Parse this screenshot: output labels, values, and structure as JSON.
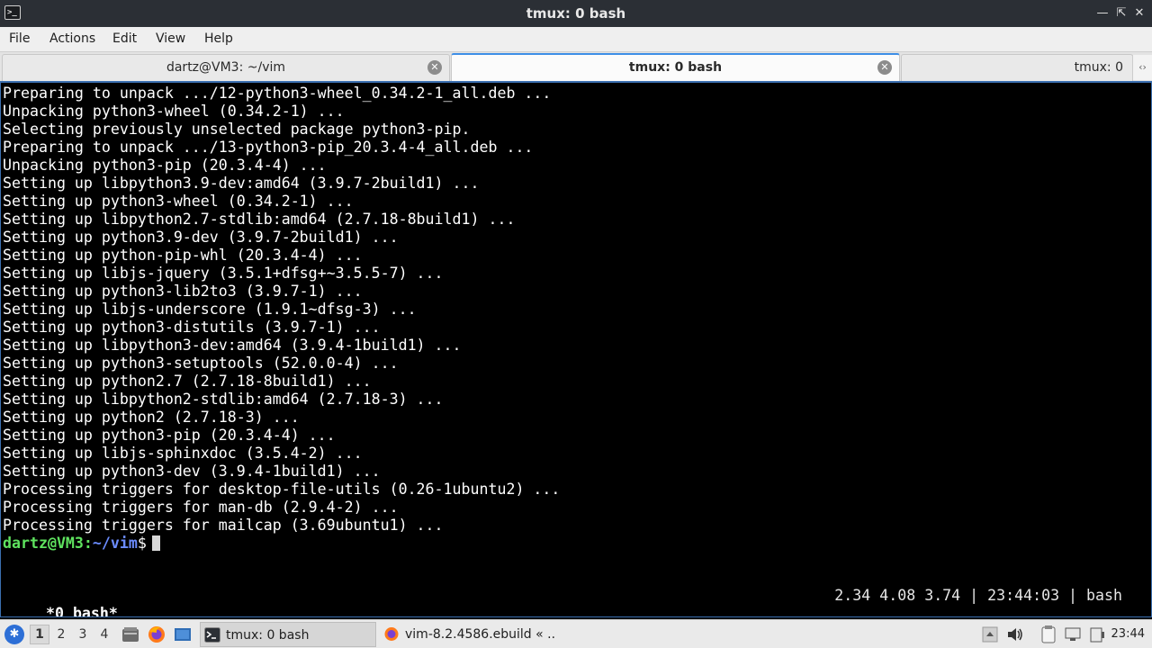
{
  "window": {
    "title": "tmux: 0 bash",
    "icon": "terminal-icon",
    "controls": [
      "minimize-icon",
      "restore-icon",
      "close-icon"
    ]
  },
  "menu": [
    "File",
    "Actions",
    "Edit",
    "View",
    "Help"
  ],
  "tabs": [
    {
      "label": "dartz@VM3: ~/vim",
      "active": false
    },
    {
      "label": "tmux: 0 bash",
      "active": true
    },
    {
      "label": "tmux: 0",
      "active": false
    }
  ],
  "terminal": {
    "lines": [
      "Preparing to unpack .../12-python3-wheel_0.34.2-1_all.deb ...",
      "Unpacking python3-wheel (0.34.2-1) ...",
      "Selecting previously unselected package python3-pip.",
      "Preparing to unpack .../13-python3-pip_20.3.4-4_all.deb ...",
      "Unpacking python3-pip (20.3.4-4) ...",
      "Setting up libpython3.9-dev:amd64 (3.9.7-2build1) ...",
      "Setting up python3-wheel (0.34.2-1) ...",
      "Setting up libpython2.7-stdlib:amd64 (2.7.18-8build1) ...",
      "Setting up python3.9-dev (3.9.7-2build1) ...",
      "Setting up python-pip-whl (20.3.4-4) ...",
      "Setting up libjs-jquery (3.5.1+dfsg+~3.5.5-7) ...",
      "Setting up python3-lib2to3 (3.9.7-1) ...",
      "Setting up libjs-underscore (1.9.1~dfsg-3) ...",
      "Setting up python3-distutils (3.9.7-1) ...",
      "Setting up libpython3-dev:amd64 (3.9.4-1build1) ...",
      "Setting up python3-setuptools (52.0.0-4) ...",
      "Setting up python2.7 (2.7.18-8build1) ...",
      "Setting up libpython2-stdlib:amd64 (2.7.18-3) ...",
      "Setting up python2 (2.7.18-3) ...",
      "Setting up python3-pip (20.3.4-4) ...",
      "Setting up libjs-sphinxdoc (3.5.4-2) ...",
      "Setting up python3-dev (3.9.4-1build1) ...",
      "Processing triggers for desktop-file-utils (0.26-1ubuntu2) ...",
      "Processing triggers for man-db (2.9.4-2) ...",
      "Processing triggers for mailcap (3.69ubuntu1) ..."
    ],
    "prompt": {
      "user_host": "dartz@VM3",
      "sep": ":",
      "path": "~/vim",
      "symbol": "$"
    },
    "tmux_status": {
      "window": "*0 bash*",
      "right": "2.34 4.08 3.74 | 23:44:03 | bash"
    }
  },
  "taskbar": {
    "workspaces": [
      "1",
      "2",
      "3",
      "4"
    ],
    "active_workspace": "1",
    "tasks": [
      {
        "label": "tmux: 0 bash",
        "icon": "terminal-icon",
        "active": true
      },
      {
        "label": "vim-8.2.4586.ebuild « ...",
        "icon": "firefox-icon",
        "active": false
      }
    ],
    "clock": "23:44"
  }
}
